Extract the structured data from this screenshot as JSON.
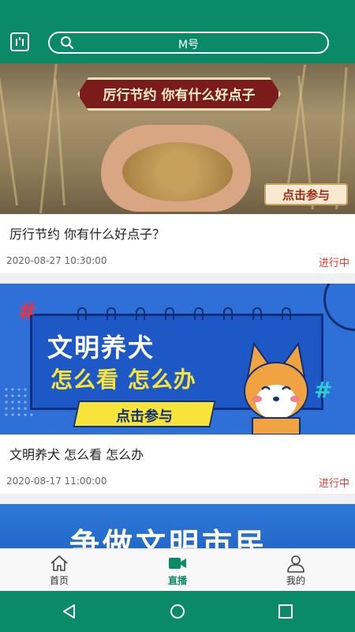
{
  "header": {
    "scan_icon": "scan-icon",
    "search_icon": "search-icon",
    "search_text": "M号",
    "accent": "#0b8a68"
  },
  "cards": [
    {
      "banner_headline": "厉行节约 你有什么好点子",
      "banner_button": "点击参与",
      "title": "厉行节约 你有什么好点子？",
      "date": "2020-08-27 10:30:00",
      "status": "进行中"
    },
    {
      "banner_headline": "文明养犬",
      "banner_subhead": "怎么看 怎么办",
      "banner_button": "点击参与",
      "title": "文明养犬 怎么看 怎么办",
      "date": "2020-08-17 11:00:00",
      "status": "进行中"
    },
    {
      "banner_headline": "争做文明市民"
    }
  ],
  "status_color": "#e23b2e",
  "bottom_nav": [
    {
      "label": "首页",
      "icon": "home-icon",
      "active": false
    },
    {
      "label": "直播",
      "icon": "video-camera-icon",
      "active": true
    },
    {
      "label": "我的",
      "icon": "person-icon",
      "active": false
    }
  ],
  "system_nav": [
    "back-icon",
    "home-circle-icon",
    "recents-icon"
  ]
}
